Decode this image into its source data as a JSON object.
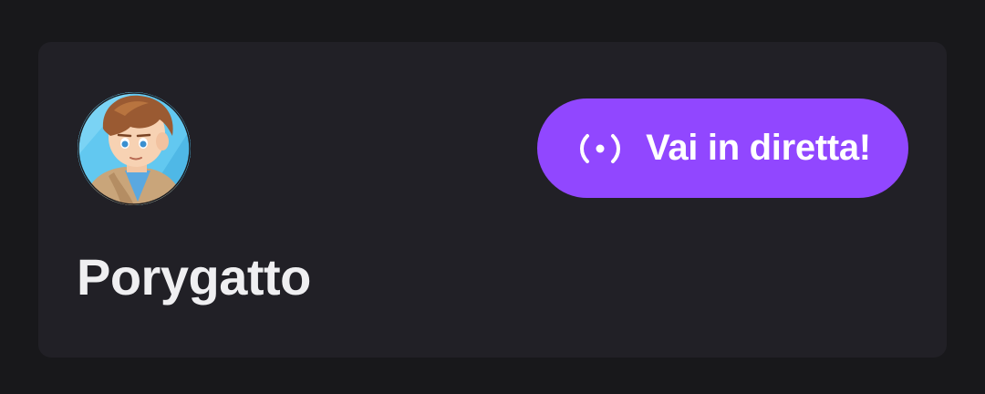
{
  "channel": {
    "username": "Porygatto",
    "avatar_icon": "avatar-illustration"
  },
  "live_button": {
    "label": "Vai in diretta!",
    "icon": "broadcast-icon",
    "color": "#9147ff"
  },
  "colors": {
    "background": "#18181b",
    "card": "#212026",
    "text": "#efeff1"
  }
}
